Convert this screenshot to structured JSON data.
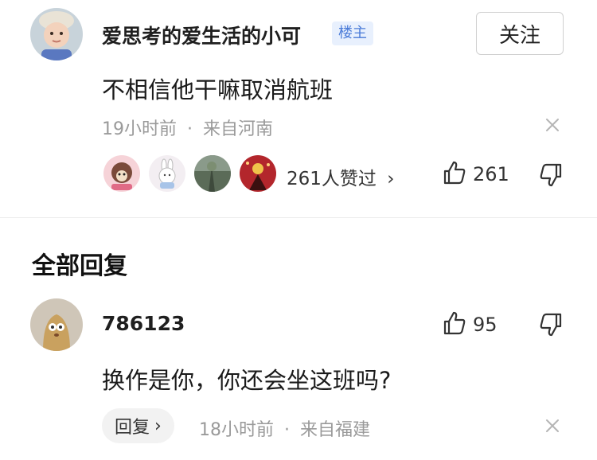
{
  "post": {
    "author": "爱思考的爱生活的小可",
    "badge": "楼主",
    "follow_label": "关注",
    "content": "不相信他干嘛取消航班",
    "time": "19小时前",
    "location": "来自河南",
    "meta_separator": "·",
    "liked_summary": "261人赞过",
    "liked_arrow": "›",
    "like_count": "261"
  },
  "section": {
    "title": "全部回复"
  },
  "reply": {
    "author": "786123",
    "content": "换作是你，你还会坐这班吗?",
    "like_count": "95",
    "reply_label": "回复",
    "reply_arrow": "›",
    "time": "18小时前",
    "location": "来自福建",
    "meta_separator": "·"
  },
  "icons": {
    "close": "close-icon",
    "thumb_up": "thumb-up-icon",
    "thumb_down": "thumb-down-icon"
  },
  "colors": {
    "badge_text": "#4a7bd8",
    "badge_bg": "#e8f0fd",
    "meta_gray": "#9a9a9a",
    "divider": "#ececec"
  }
}
